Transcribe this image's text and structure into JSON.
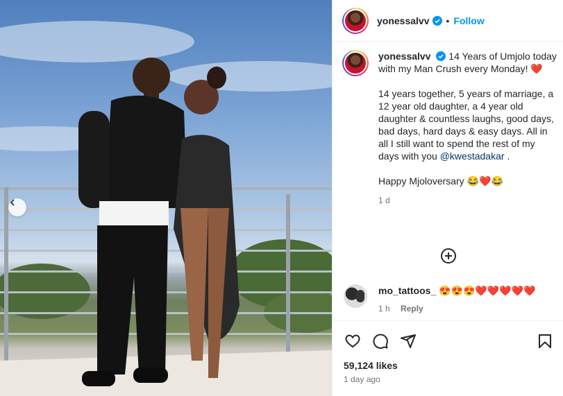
{
  "post": {
    "username": "yonessalvv",
    "dot": "•",
    "follow_label": "Follow"
  },
  "caption": {
    "username": "yonessalvv",
    "line1": "14 Years of Umjolo today with my Man Crush every Monday! ❤️",
    "line2": "14 years together, 5 years of marriage, a 12 year old daughter, a 4 year old daughter & countless laughs, good days, bad days, hard days & easy days. All in all I still want to spend the rest of my days with you ",
    "mention": "@kwestadakar",
    "line2_end": " .",
    "line3": "Happy Mjoloversary 😂❤️😂",
    "age": "1 d"
  },
  "comment": {
    "username": "mo_tattoos_",
    "text": "😍😍😍❤️❤️❤️❤️❤️",
    "age": "1 h",
    "reply_label": "Reply"
  },
  "engagement": {
    "likes": "59,124 likes",
    "posted": "1 day ago"
  },
  "icons": [
    "heart-icon",
    "comment-icon",
    "share-icon",
    "bookmark-icon",
    "add-circle-icon",
    "chevron-left-icon",
    "verified-badge-icon"
  ],
  "colors": {
    "accent": "#0095f6",
    "verified": "#0095f6",
    "mention": "#00376b"
  }
}
